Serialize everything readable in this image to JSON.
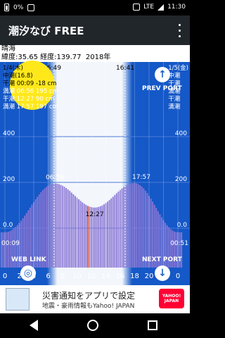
{
  "statusbar": {
    "battery_pct": "0%",
    "network": "LTE",
    "clock": "11:30"
  },
  "appbar": {
    "title": "潮汐なび FREE"
  },
  "info": {
    "place": "晴海",
    "coords": "緯度:35.65 経度:139.77",
    "year": "2018年"
  },
  "left_day": {
    "date": "1/4(木)",
    "tide_type": "中潮(16.8)",
    "events": [
      {
        "label": "干潮",
        "time": "00:09",
        "value": "-18 cm"
      },
      {
        "label": "満潮",
        "time": "06:56",
        "value": "195 cm"
      },
      {
        "label": "干潮",
        "time": "12:27",
        "value": "90 cm"
      },
      {
        "label": "満潮",
        "time": "17:57",
        "value": "197 cm"
      }
    ]
  },
  "right_day": {
    "date": "1/5(金)",
    "tide_type": "中潮",
    "labels": [
      "干潮",
      "満潮",
      "干潮",
      "満潮"
    ]
  },
  "chart_labels": {
    "sunrise": "6:49",
    "sunset": "16:41",
    "y400_left": "400",
    "y200_left": "200",
    "y0_left": "0.0",
    "y400_right": "400",
    "y200_right": "200",
    "y0_right": "0.0",
    "ann_high1": "06:56",
    "ann_low2": "12:27",
    "ann_high2": "17:57",
    "ann_low1": "00:09",
    "ann_next_low": "00:51"
  },
  "buttons": {
    "prev_port": "PREV PORT",
    "next_port": "NEXT PORT",
    "web_link": "WEB LINK"
  },
  "x_axis": [
    "0",
    "2",
    "4",
    "6",
    "8",
    "10",
    "12",
    "14",
    "16",
    "18",
    "20",
    "22",
    "0"
  ],
  "chart_data": {
    "type": "bar",
    "x": [
      0,
      6.93,
      12.45,
      17.95,
      24
    ],
    "values": [
      -18,
      195,
      90,
      197,
      -18
    ],
    "xlabel": "",
    "ylabel": "",
    "xlim": [
      0,
      24
    ],
    "ylim": [
      -100,
      500
    ]
  },
  "ad": {
    "line1": "災害通知をアプリで設定",
    "line2": "地震・豪雨情報もYahoo! JAPAN",
    "logo": "YAHOO! JAPAN"
  },
  "colors": {
    "background": "#1558c7",
    "tide_fill": "#8b78d6",
    "daylight": "#ffffff",
    "now_line": "#ff5a1a",
    "sun": "#ffe81a"
  }
}
